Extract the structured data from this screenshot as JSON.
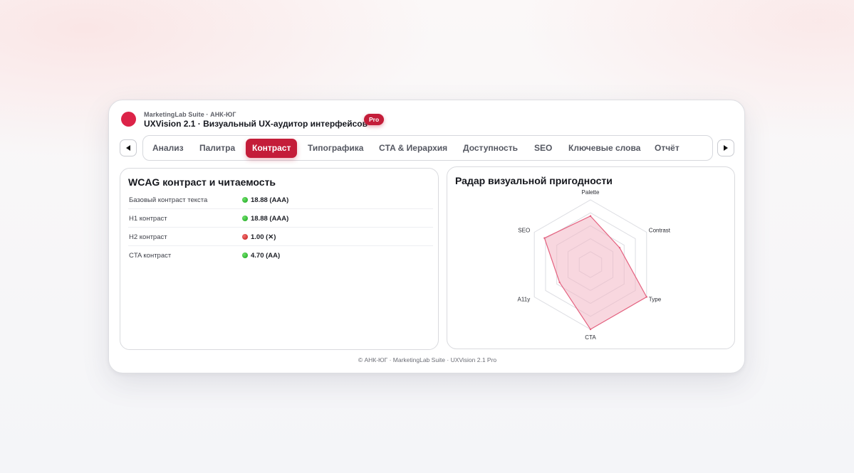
{
  "header": {
    "suite": "MarketingLab Suite · АНК-ЮГ",
    "title": "UXVision 2.1 · Визуальный UX-аудитор интерфейсов",
    "badge": "Pro",
    "brand_color": "#dc2348"
  },
  "nav": {
    "prev_icon": "triangle-left",
    "next_icon": "triangle-right",
    "active_tab": "Контраст",
    "active_color": "#c41d39",
    "tabs": [
      {
        "label": "Анализ"
      },
      {
        "label": "Палитра"
      },
      {
        "label": "Контраст"
      },
      {
        "label": "Типографика"
      },
      {
        "label": "CTA & Иерархия"
      },
      {
        "label": "Доступность"
      },
      {
        "label": "SEO"
      },
      {
        "label": "Ключевые слова"
      },
      {
        "label": "Отчёт"
      }
    ]
  },
  "contrast": {
    "title": "WCAG контраст и читаемость",
    "rows": [
      {
        "label": "Базовый контраст текста",
        "status": "pass",
        "value": "18.88 (AAA)"
      },
      {
        "label": "H1 контраст",
        "status": "pass",
        "value": "18.88 (AAA)"
      },
      {
        "label": "H2 контраст",
        "status": "fail",
        "value": "1.00 (✕)"
      },
      {
        "label": "CTA контраст",
        "status": "pass",
        "value": "4.70 (AA)"
      }
    ],
    "status_colors": {
      "pass": "#16a31b",
      "fail": "#c01a1a"
    }
  },
  "radar": {
    "title": "Радар визуальной пригодности",
    "fill_color": "#f2b6c4",
    "stroke_color": "#e4607e"
  },
  "chart_data": {
    "type": "radar",
    "categories": [
      "Palette",
      "Contrast",
      "Type",
      "CTA",
      "A11y",
      "SEO"
    ],
    "values": [
      0.75,
      0.52,
      1.0,
      1.0,
      0.55,
      0.82
    ],
    "ylim": [
      0,
      1
    ],
    "grid": true
  },
  "footer": {
    "text": "© АНК-ЮГ · MarketingLab Suite · UXVision 2.1 Pro"
  }
}
